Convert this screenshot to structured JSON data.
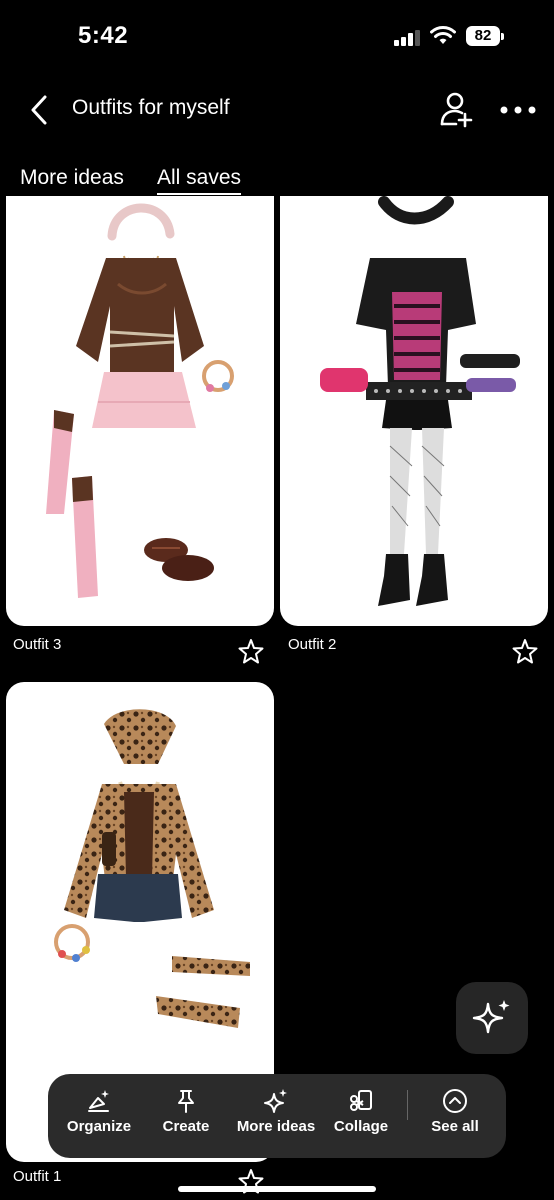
{
  "status_bar": {
    "time": "5:42",
    "battery": "82"
  },
  "header": {
    "title": "Outfits for myself"
  },
  "tabs": [
    {
      "label": "More ideas",
      "active": false
    },
    {
      "label": "All saves",
      "active": true
    }
  ],
  "pins": [
    {
      "title": "Outfit 3"
    },
    {
      "title": "Outfit 2"
    },
    {
      "title": "Outfit 1"
    }
  ],
  "toolbar": {
    "organize": "Organize",
    "create": "Create",
    "more_ideas": "More ideas",
    "collage": "Collage",
    "see_all": "See all"
  },
  "icons": {
    "back": "chevron-left-icon",
    "add_collaborator": "add-person-icon",
    "more": "ellipsis-icon",
    "save": "star-icon",
    "fab": "sparkle-icon"
  },
  "colors": {
    "background": "#000000",
    "toolbar": "#2b2b2b",
    "text": "#ffffff"
  }
}
